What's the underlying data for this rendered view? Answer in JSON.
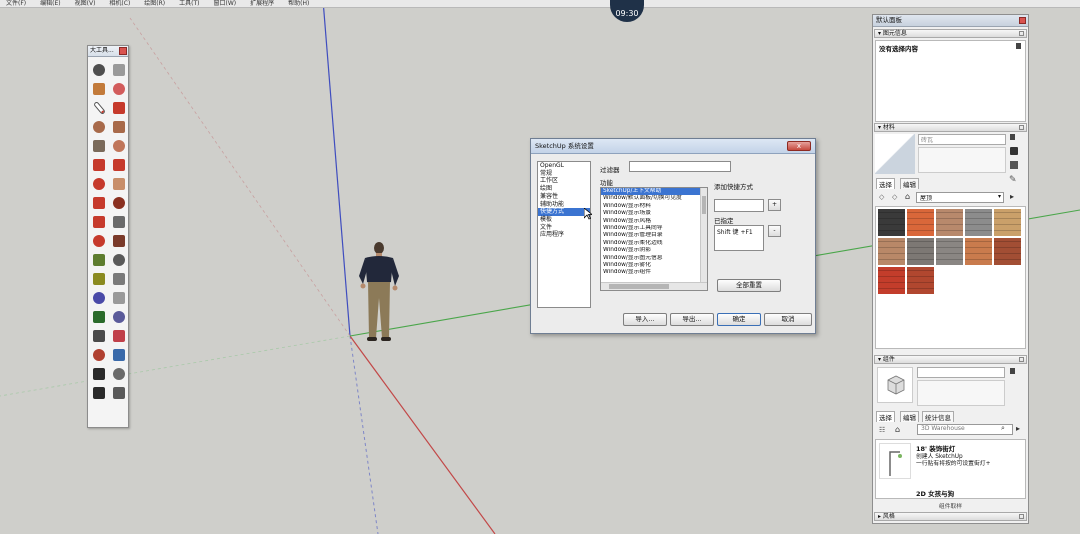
{
  "menubar": {
    "items": [
      "文件(F)",
      "编辑(E)",
      "视图(V)",
      "相机(C)",
      "绘图(R)",
      "工具(T)",
      "窗口(W)",
      "扩展程序",
      "帮助(H)"
    ]
  },
  "clock": "09:30",
  "colors": {
    "viewport_bg": "#cfcfcb",
    "axis_blue": "#3f4dbf",
    "axis_red": "#c24848",
    "axis_green": "#4aa64a",
    "selection": "#3b74d1"
  },
  "tool_palette": {
    "title": "大工具...",
    "tools": [
      "select-icon",
      "eraser-icon",
      "paint-bucket-icon",
      "eraser-alt-icon",
      "line-icon",
      "freehand-icon",
      "rectangle-icon",
      "rotated-rectangle-icon",
      "circle-icon",
      "polygon-icon",
      "arc-icon",
      "two-point-arc-icon",
      "pie-icon",
      "three-point-arc-icon",
      "move-icon",
      "push-pull-icon",
      "rotate-icon",
      "follow-me-icon",
      "scale-icon",
      "offset-icon",
      "tape-measure-icon",
      "dimension-icon",
      "protractor-icon",
      "text-icon",
      "axes-icon",
      "3d-text-icon",
      "orbit-icon",
      "pan-icon",
      "zoom-icon",
      "zoom-window-icon",
      "zoom-extents-icon",
      "previous-view-icon",
      "position-camera-icon",
      "look-around-icon",
      "walk-icon",
      "section-plane-icon"
    ]
  },
  "preferences_dialog": {
    "title": "SketchUp 系统设置",
    "close_label": "x",
    "categories": [
      "OpenGL",
      "常规",
      "工作区",
      "绘图",
      "兼容性",
      "辅助功能",
      "快捷方式",
      "模板",
      "文件",
      "应用程序"
    ],
    "selected_category_index": 6,
    "filter_label": "过滤器",
    "filter_value": "",
    "function_label": "功能",
    "functions": [
      "SketchUp/上下文帮助",
      "Window/默认面板/切换可见度",
      "Window/显示材料",
      "Window/显示场景",
      "Window/显示风格",
      "Window/显示工具向导",
      "Window/显示管理目录",
      "Window/显示柔化边线",
      "Window/显示阴影",
      "Window/显示图元信息",
      "Window/显示雾化",
      "Window/显示组件"
    ],
    "selected_function_index": 0,
    "add_shortcut_label": "添加快捷方式",
    "add_button": "+",
    "assigned_label": "已指定",
    "assigned_values": [
      "Shift 键 +F1"
    ],
    "remove_button": "-",
    "reset_all_button": "全部重置",
    "import_button": "导入...",
    "export_button": "导出...",
    "ok_button": "确定",
    "cancel_button": "取消"
  },
  "tray": {
    "title": "默认面板",
    "entity_info": {
      "header": "图元信息",
      "status": "没有选择内容"
    },
    "materials": {
      "header": "材料",
      "name_placeholder": "砖瓦",
      "tabs": [
        "选择",
        "编辑"
      ],
      "collection": "屋顶",
      "swatches": [
        "#3a3a3a",
        "#d9673a",
        "#b8896c",
        "#8c8c8c",
        "#caa06a",
        "#b98868",
        "#7d7874",
        "#8a8683",
        "#c97b4d",
        "#a24e34",
        "#c33d2b",
        "#b1472f"
      ]
    },
    "components": {
      "header": "组件",
      "tabs": [
        "选择",
        "编辑",
        "统计信息"
      ],
      "search_placeholder": "3D Warehouse",
      "items": [
        {
          "title": "18' 装饰街灯",
          "author": "创建人 SketchUp",
          "desc": "一行贴有将按的可设置街灯+"
        },
        {
          "title": "2D 女孩与狗",
          "author": "",
          "desc": ""
        }
      ],
      "footer": "组件取样"
    },
    "styles": {
      "header": "风格"
    }
  }
}
